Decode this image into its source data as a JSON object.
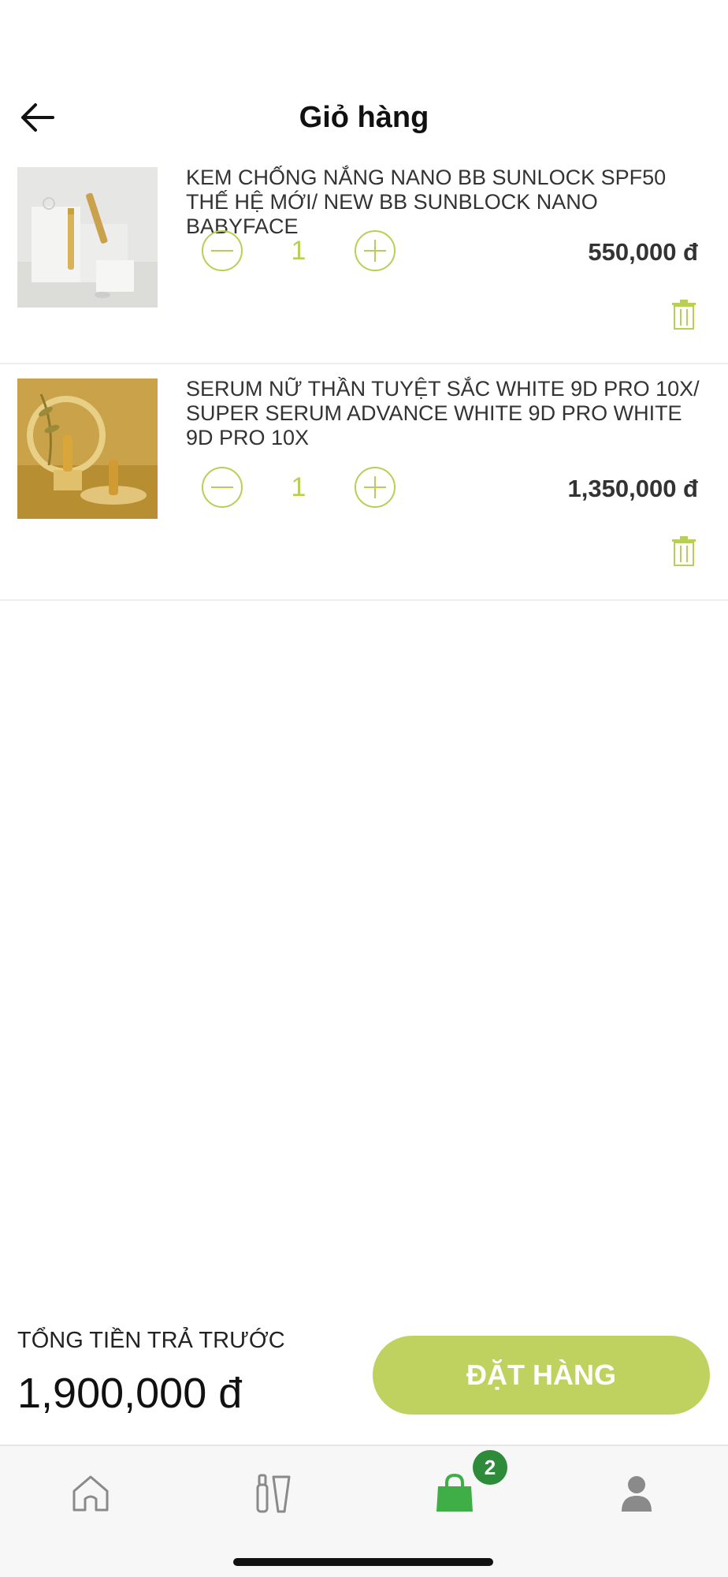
{
  "header": {
    "title": "Giỏ hàng"
  },
  "cart": {
    "items": [
      {
        "name": "KEM CHỐNG NẮNG NANO BB SUNLOCK SPF50 THẾ HỆ MỚI/ NEW BB SUNBLOCK NANO BABYFACE",
        "quantity": "1",
        "price": "550,000 đ"
      },
      {
        "name": "SERUM NỮ THẦN TUYỆT SẮC WHITE 9D PRO 10X/ SUPER SERUM ADVANCE WHITE 9D PRO WHITE 9D PRO 10X",
        "quantity": "1",
        "price": "1,350,000 đ"
      }
    ]
  },
  "footer": {
    "total_label": "TỔNG TIỀN TRẢ TRƯỚC",
    "total_value": "1,900,000 đ",
    "order_button": "ĐẶT HÀNG"
  },
  "tabbar": {
    "tabs": [
      {
        "icon": "home-icon"
      },
      {
        "icon": "products-icon"
      },
      {
        "icon": "cart-bag-icon",
        "active": true
      },
      {
        "icon": "profile-icon"
      }
    ],
    "cart_badge": "2"
  },
  "colors": {
    "accent": "#bfd25f",
    "accent_line": "#b7cf55",
    "active_tab": "#3fae47",
    "badge": "#2e8b3a",
    "inactive_icon": "#888888"
  }
}
